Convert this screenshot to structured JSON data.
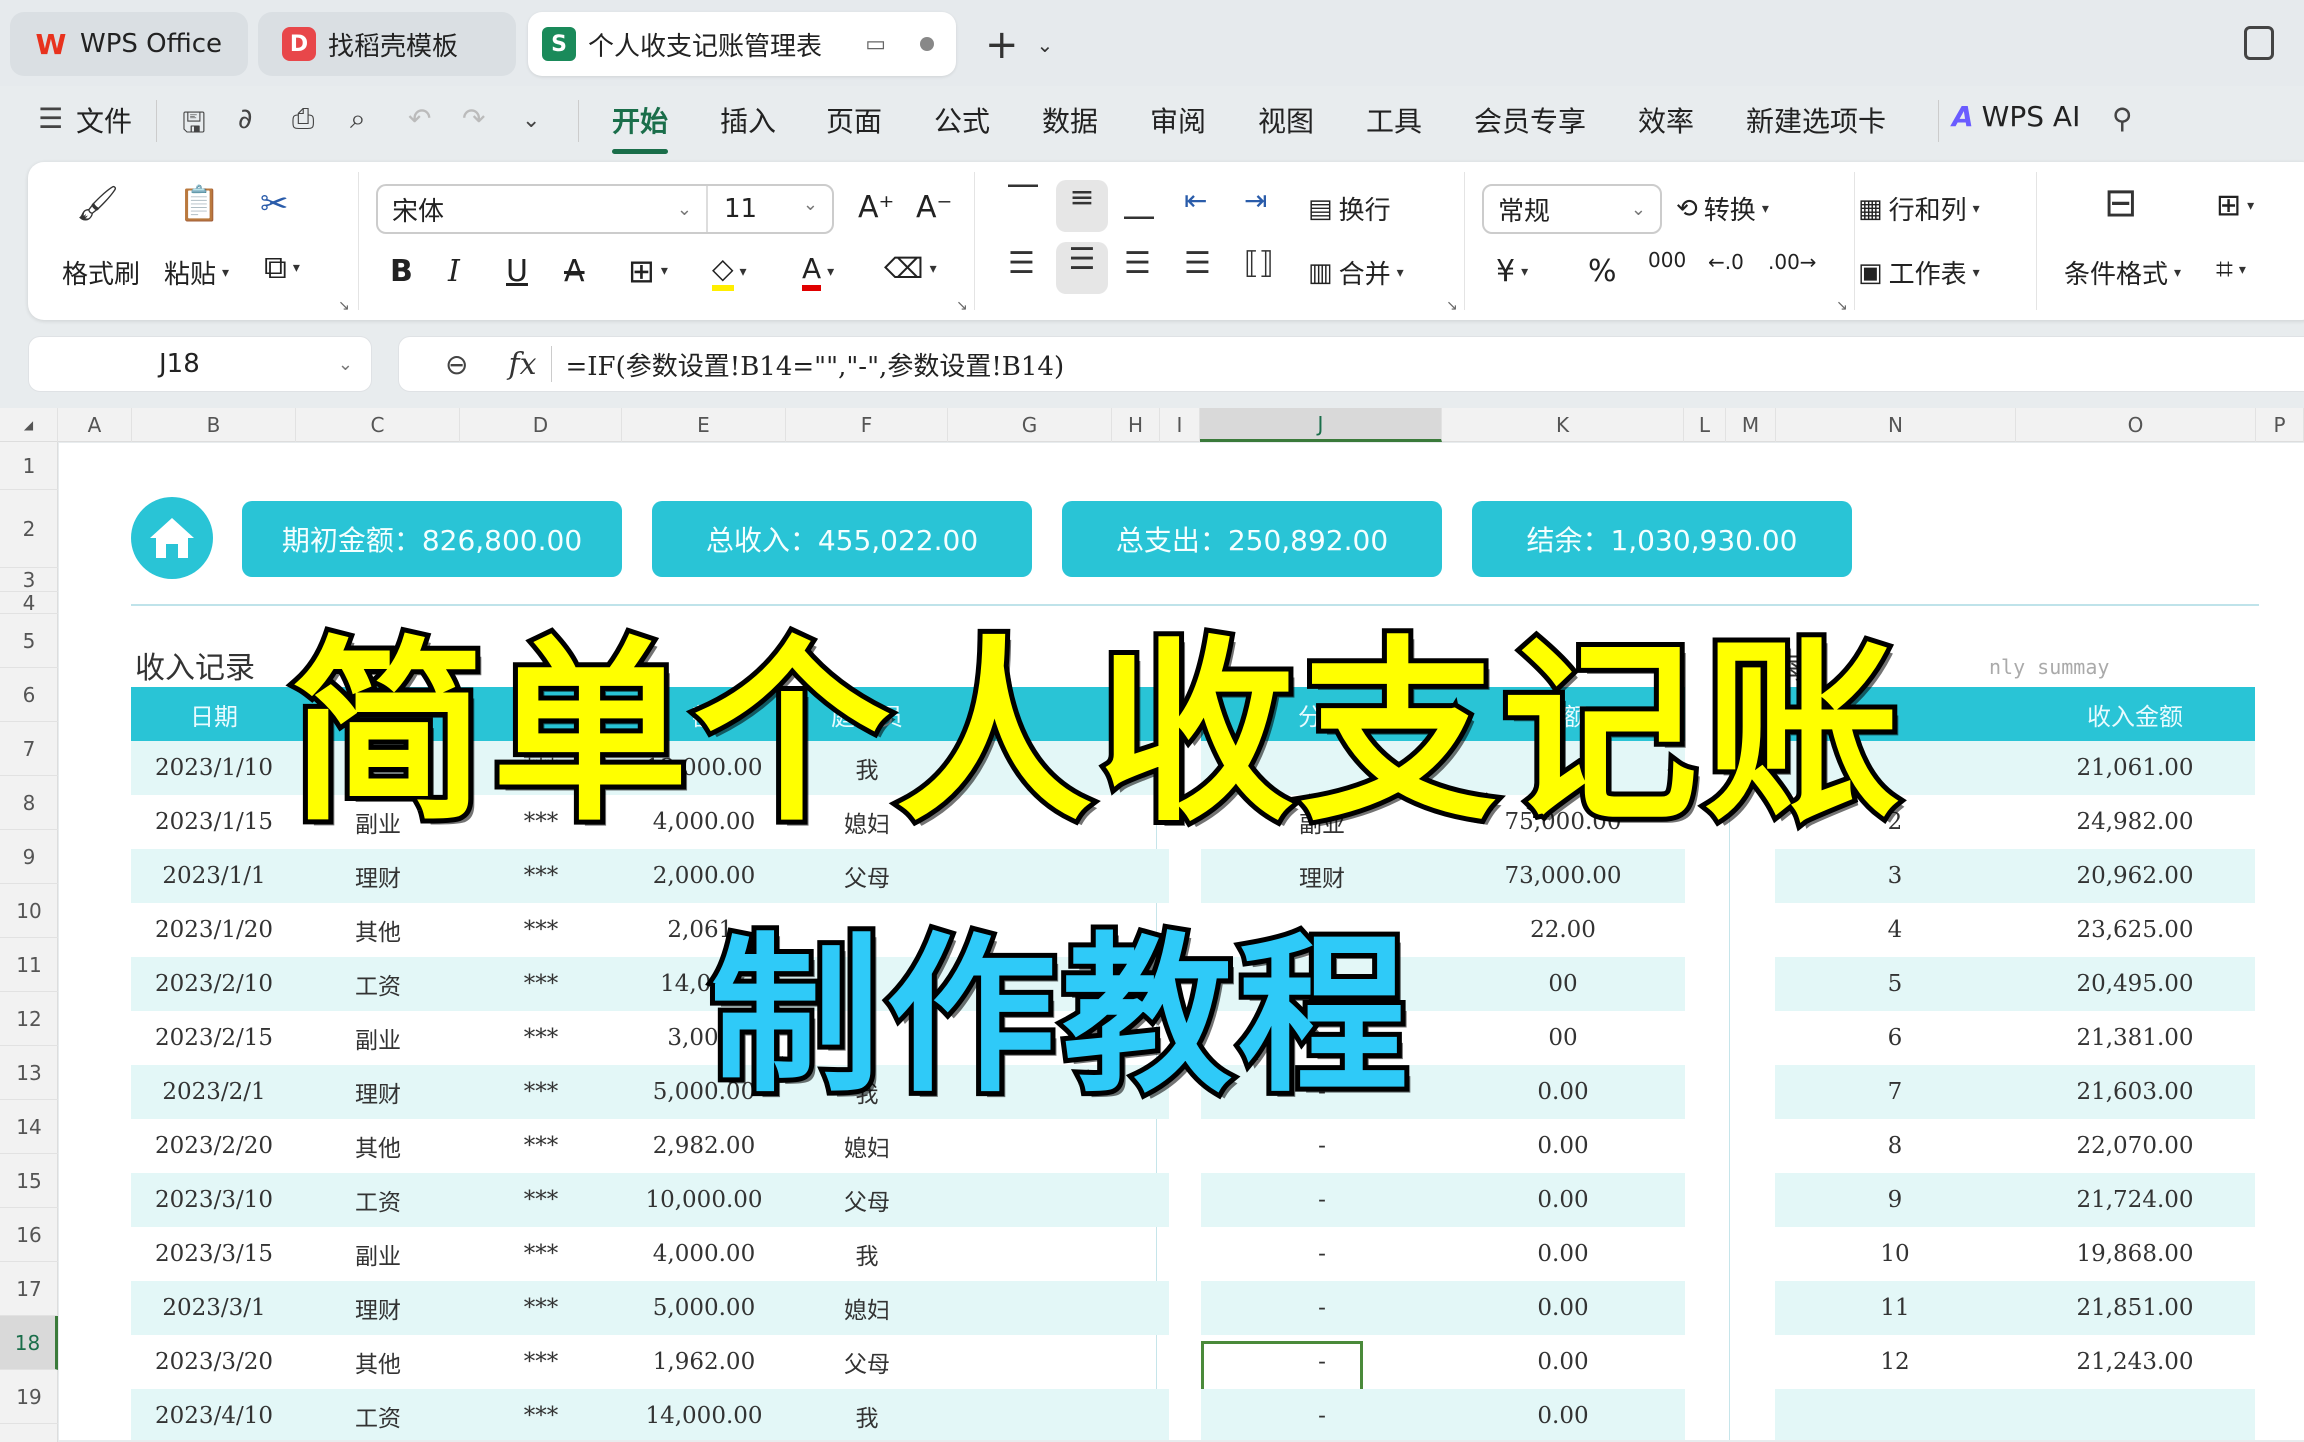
{
  "tabs": [
    {
      "label": "WPS Office",
      "icon": "wps-logo-icon",
      "state": "inactive"
    },
    {
      "label": "找稻壳模板",
      "icon": "docer-logo-icon",
      "state": "inactive"
    },
    {
      "label": "个人收支记账管理表",
      "icon": "spreadsheet-s-icon",
      "state": "active"
    }
  ],
  "menu": {
    "file": "文件",
    "items": [
      "开始",
      "插入",
      "页面",
      "公式",
      "数据",
      "审阅",
      "视图",
      "工具",
      "会员专享",
      "效率",
      "新建选项卡"
    ],
    "selected": "开始",
    "ai": "WPS AI"
  },
  "ribbon": {
    "format_painter": "格式刷",
    "paste": "粘贴",
    "font_name": "宋体",
    "font_size": "11",
    "wrap": "换行",
    "merge": "合并",
    "number_format": "常规",
    "convert": "转换",
    "rows_cols": "行和列",
    "worksheet": "工作表",
    "cond_format": "条件格式",
    "bold": "B",
    "italic": "I",
    "underline": "U",
    "currency": "¥",
    "percent": "%",
    "thousands": "000",
    "colors": {
      "highlight": "#ffee00",
      "font": "#e00000",
      "accent": "#1a6e4a"
    }
  },
  "formula_bar": {
    "cell_ref": "J18",
    "formula": "=IF(参数设置!B14=\"\",\"-\",参数设置!B14)"
  },
  "columns": [
    "A",
    "B",
    "C",
    "D",
    "E",
    "F",
    "G",
    "H",
    "I",
    "J",
    "K",
    "L",
    "M",
    "N",
    "O",
    "P"
  ],
  "selected_column": "J",
  "rows": [
    "1",
    "2",
    "3",
    "4",
    "5",
    "6",
    "7",
    "8",
    "9",
    "10",
    "11",
    "12",
    "13",
    "14",
    "15",
    "16",
    "17",
    "18",
    "19"
  ],
  "selected_row": "18",
  "summary_cards": [
    {
      "label": "期初金额：826,800.00"
    },
    {
      "label": "总收入：455,022.00"
    },
    {
      "label": "总支出：250,892.00"
    },
    {
      "label": "结余：1,030,930.00"
    }
  ],
  "income_section": {
    "title": "收入记录",
    "headers": [
      "日期",
      "",
      "",
      "额",
      "庭成员"
    ],
    "rows": [
      [
        "2023/1/10",
        "",
        "***",
        "13,000.00",
        "我"
      ],
      [
        "2023/1/15",
        "副业",
        "***",
        "4,000.00",
        "媳妇"
      ],
      [
        "2023/1/1",
        "理财",
        "***",
        "2,000.00",
        "父母"
      ],
      [
        "2023/1/20",
        "其他",
        "***",
        "2,061.",
        ""
      ],
      [
        "2023/2/10",
        "工资",
        "***",
        "14,000.",
        ""
      ],
      [
        "2023/2/15",
        "副业",
        "***",
        "3,000.",
        ""
      ],
      [
        "2023/2/1",
        "理财",
        "***",
        "5,000.00",
        "我"
      ],
      [
        "2023/2/20",
        "其他",
        "***",
        "2,982.00",
        "媳妇"
      ],
      [
        "2023/3/10",
        "工资",
        "***",
        "10,000.00",
        "父母"
      ],
      [
        "2023/3/15",
        "副业",
        "***",
        "4,000.00",
        "我"
      ],
      [
        "2023/3/1",
        "理财",
        "***",
        "5,000.00",
        "媳妇"
      ],
      [
        "2023/3/20",
        "其他",
        "***",
        "1,962.00",
        "父母"
      ],
      [
        "2023/4/10",
        "工资",
        "***",
        "14,000.00",
        "我"
      ]
    ]
  },
  "category_section": {
    "headers": [
      "分类",
      "金额"
    ],
    "rows": [
      [
        "",
        ""
      ],
      [
        "副业",
        "75,000.00"
      ],
      [
        "理财",
        "73,000.00"
      ],
      [
        "",
        "22.00"
      ],
      [
        "",
        "00"
      ],
      [
        "",
        "00"
      ],
      [
        "-",
        "0.00"
      ],
      [
        "-",
        "0.00"
      ],
      [
        "-",
        "0.00"
      ],
      [
        "-",
        "0.00"
      ],
      [
        "-",
        "0.00"
      ],
      [
        "-",
        "0.00"
      ],
      [
        "-",
        "0.00"
      ]
    ]
  },
  "monthly_section": {
    "title_partial": "每",
    "subtitle": "nly summay",
    "headers": [
      "",
      "收入金额"
    ],
    "rows": [
      [
        "",
        "21,061.00"
      ],
      [
        "2",
        "24,982.00"
      ],
      [
        "3",
        "20,962.00"
      ],
      [
        "4",
        "23,625.00"
      ],
      [
        "5",
        "20,495.00"
      ],
      [
        "6",
        "21,381.00"
      ],
      [
        "7",
        "21,603.00"
      ],
      [
        "8",
        "22,070.00"
      ],
      [
        "9",
        "21,724.00"
      ],
      [
        "10",
        "19,868.00"
      ],
      [
        "11",
        "21,851.00"
      ],
      [
        "12",
        "21,243.00"
      ],
      [
        "",
        ""
      ]
    ]
  },
  "overlay": {
    "title": "简单个人收支记账",
    "subtitle": "制作教程",
    "title_color": "#ffff00",
    "subtitle_color": "#2fcaf8"
  },
  "theme": {
    "teal": "#29c4d6",
    "row_alt": "#e3f7f7"
  }
}
